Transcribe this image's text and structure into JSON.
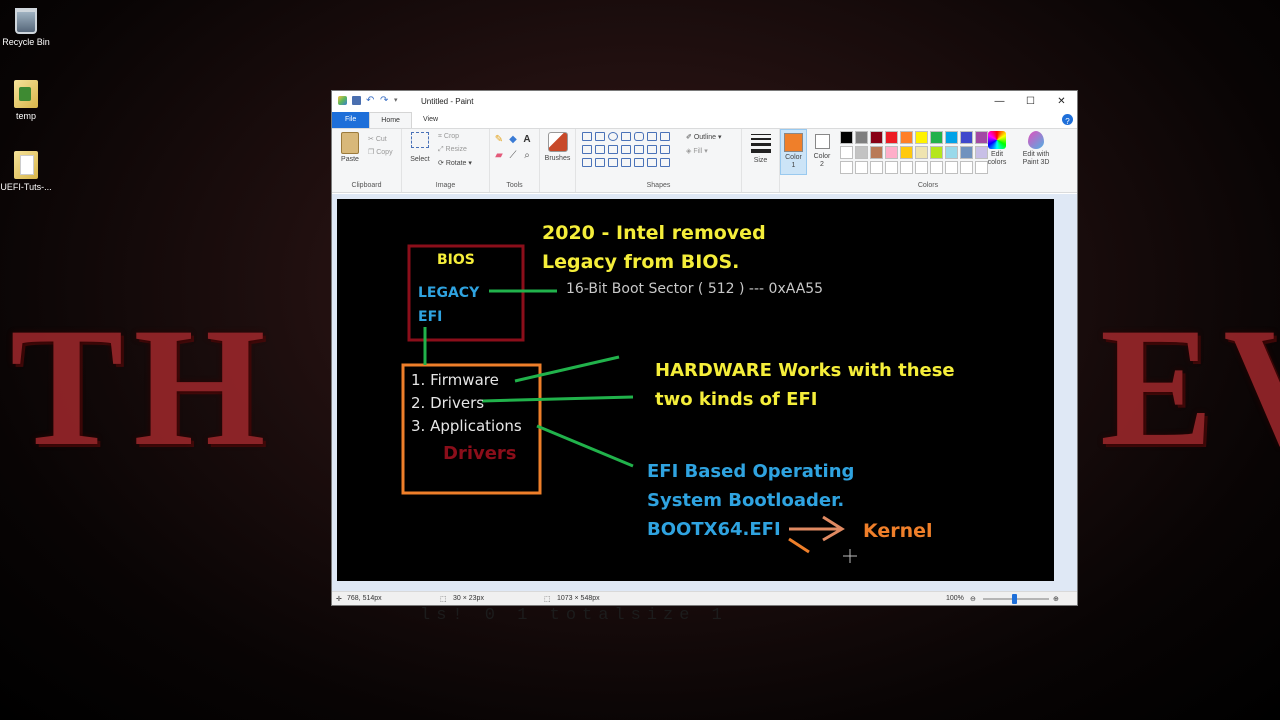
{
  "desktop": {
    "icons": [
      {
        "label": "Recycle Bin"
      },
      {
        "label": "temp"
      },
      {
        "label": "UEFI-Tuts-..."
      }
    ],
    "wallpaper_left": "TH",
    "wallpaper_right": "EV",
    "wallpaper_bottom": "ls!   0   1   totalsize   1"
  },
  "paint": {
    "title": "Untitled - Paint",
    "tabs": {
      "file": "File",
      "home": "Home",
      "view": "View"
    },
    "help": "?",
    "groups": {
      "clipboard": {
        "label": "Clipboard",
        "paste": "Paste",
        "cut": "Cut",
        "copy": "Copy"
      },
      "image": {
        "label": "Image",
        "select": "Select",
        "crop": "Crop",
        "resize": "Resize",
        "rotate": "Rotate"
      },
      "tools": {
        "label": "Tools"
      },
      "brushes": {
        "label": "Brushes"
      },
      "shapes": {
        "label": "Shapes",
        "outline": "Outline",
        "fill": "Fill"
      },
      "size": {
        "label": "Size"
      },
      "colors": {
        "label": "Colors",
        "color1": "Color 1",
        "color2": "Color 2",
        "edit": "Edit colors",
        "paint3d": "Edit with Paint 3D"
      }
    },
    "color1": "#ef7f2a",
    "palette": [
      "#000000",
      "#7f7f7f",
      "#880015",
      "#ed1c24",
      "#ff7f27",
      "#fff200",
      "#22b14c",
      "#00a2e8",
      "#3f48cc",
      "#a349a4",
      "#ffffff",
      "#c3c3c3",
      "#b97a57",
      "#ffaec9",
      "#ffc90e",
      "#efe4b0",
      "#b5e61d",
      "#99d9ea",
      "#7092be",
      "#c8bfe7",
      "#ffffff",
      "#ffffff",
      "#ffffff",
      "#ffffff",
      "#ffffff",
      "#ffffff",
      "#ffffff",
      "#ffffff",
      "#ffffff",
      "#ffffff"
    ],
    "status": {
      "cursor": "768, 514px",
      "selection": "30 × 23px",
      "canvas_size": "1073 × 548px",
      "zoom": "100%"
    }
  },
  "drawing": {
    "headline_1": "2020 - Intel removed",
    "headline_2": "Legacy from BIOS.",
    "bios": "BIOS",
    "legacy": "LEGACY",
    "efi": "EFI",
    "boot_sector": "16-Bit Boot Sector ( 512 ) --- 0xAA55",
    "list_1": "1. Firmware",
    "list_2": "2. Drivers",
    "list_3": "3. Applications",
    "drivers_label": "Drivers",
    "hardware_1": "HARDWARE Works with these",
    "hardware_2": "two kinds of EFI",
    "efi_os_1": "EFI Based Operating",
    "efi_os_2": "System Bootloader.",
    "bootx64": "BOOTX64.EFI",
    "kernel": "Kernel",
    "colors": {
      "yellow": "#f5ee3a",
      "blue": "#2fa3e0",
      "orange": "#ef7f2a",
      "red": "#8b0e1a",
      "green": "#21b24b",
      "white": "#e6e6e6"
    }
  }
}
